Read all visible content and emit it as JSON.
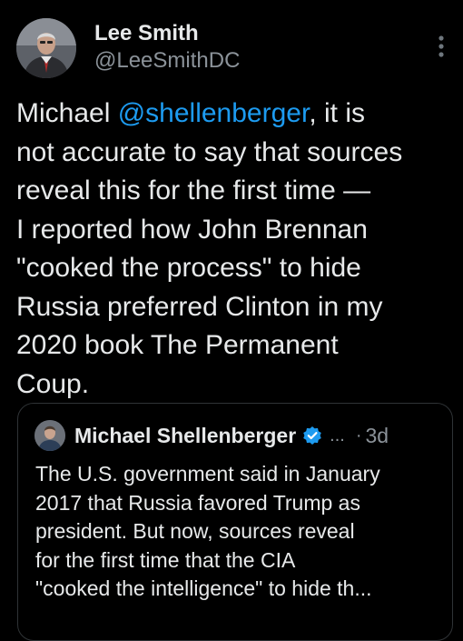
{
  "author": {
    "display_name": "Lee Smith",
    "handle": "@LeeSmithDC",
    "avatar_icon": "profile-photo"
  },
  "tweet": {
    "lines": [
      {
        "before": "Michael ",
        "mention": "@shellenberger",
        "after": ",  it is"
      },
      "not accurate to say that sources",
      "reveal this for the first time —",
      "I reported how John Brennan",
      "\"cooked the process\" to hide",
      "Russia preferred Clinton in my",
      "2020 book The Permanent",
      "Coup."
    ]
  },
  "quote": {
    "display_name": "Michael Shellenberger",
    "verified": true,
    "ellipsis": "...",
    "separator": "·",
    "time": "3d",
    "lines": [
      "The U.S. government said in January",
      "2017 that Russia favored Trump as",
      "president. But now, sources reveal",
      "for the first time that the CIA",
      "\"cooked the intelligence\" to hide th..."
    ]
  },
  "colors": {
    "background": "#000000",
    "text": "#e7e9ea",
    "secondary": "#8b9299",
    "link": "#1d9bf0",
    "border": "#2f3336"
  }
}
